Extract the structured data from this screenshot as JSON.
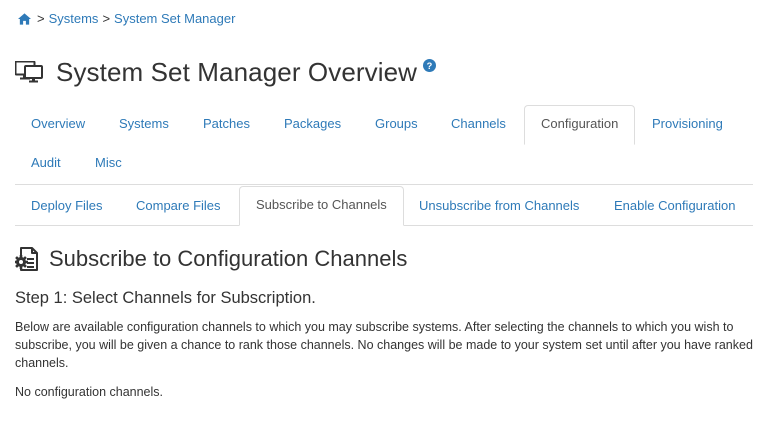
{
  "breadcrumb": {
    "home_icon": "home-icon",
    "separator": ">",
    "items": [
      "Systems",
      "System Set Manager"
    ]
  },
  "header": {
    "title": "System Set Manager Overview",
    "icon": "monitor-icon",
    "help_icon": "question-circle-icon"
  },
  "main_tabs": [
    {
      "label": "Overview"
    },
    {
      "label": "Systems"
    },
    {
      "label": "Patches"
    },
    {
      "label": "Packages"
    },
    {
      "label": "Groups"
    },
    {
      "label": "Channels"
    },
    {
      "label": "Configuration",
      "active": true
    },
    {
      "label": "Provisioning"
    },
    {
      "label": "Audit"
    },
    {
      "label": "Misc"
    }
  ],
  "sub_tabs": [
    {
      "label": "Deploy Files"
    },
    {
      "label": "Compare Files"
    },
    {
      "label": "Subscribe to Channels",
      "active": true
    },
    {
      "label": "Unsubscribe from Channels"
    },
    {
      "label": "Enable Configuration"
    }
  ],
  "section": {
    "icon": "config-file-gear-icon",
    "title": "Subscribe to Configuration Channels",
    "step_title": "Step 1: Select Channels for Subscription.",
    "description": "Below are available configuration channels to which you may subscribe systems. After selecting the channels to which you wish to subscribe, you will be given a chance to rank those channels. No changes will be made to your system set until after you have ranked channels.",
    "empty_message": "No configuration channels."
  },
  "colors": {
    "link": "#2e7ab8",
    "text": "#333333",
    "border": "#dddddd"
  }
}
